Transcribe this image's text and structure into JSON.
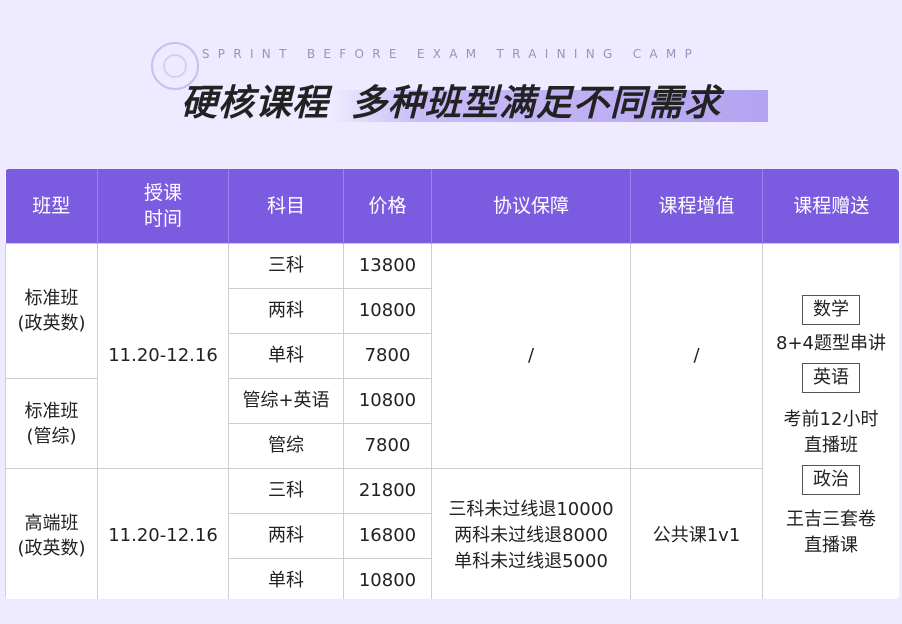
{
  "header": {
    "subtitle": "SPRINT BEFORE EXAM TRAINING CAMP",
    "title_left": "硬核课程",
    "title_right": "多种班型满足不同需求"
  },
  "table": {
    "columns": [
      "班型",
      "授课\n时间",
      "科目",
      "价格",
      "协议保障",
      "课程增值",
      "课程赠送"
    ],
    "groups": [
      {
        "class_type": "标准班\n(政英数)",
        "time": "11.20-12.16",
        "rows": [
          {
            "subject": "三科",
            "price": "13800"
          },
          {
            "subject": "两科",
            "price": "10800"
          },
          {
            "subject": "单科",
            "price": "7800"
          }
        ]
      },
      {
        "class_type": "标准班\n(管综)",
        "rows": [
          {
            "subject": "管综+英语",
            "price": "10800"
          },
          {
            "subject": "管综",
            "price": "7800"
          }
        ]
      },
      {
        "class_type": "高端班\n(政英数)",
        "time": "11.20-12.16",
        "guarantee": [
          "三科未过线退10000",
          "两科未过线退8000",
          "单科未过线退5000"
        ],
        "value_add": "公共课1v1",
        "rows": [
          {
            "subject": "三科",
            "price": "21800"
          },
          {
            "subject": "两科",
            "price": "16800"
          },
          {
            "subject": "单科",
            "price": "10800"
          }
        ]
      }
    ],
    "standard_guarantee": "/",
    "standard_value_add": "/",
    "gifts": [
      {
        "tag": "数学",
        "desc": [
          "8+4题型串讲"
        ]
      },
      {
        "tag": "英语",
        "desc": [
          "考前12小时",
          "直播班"
        ]
      },
      {
        "tag": "政治",
        "desc": [
          "王吉三套卷",
          "直播课"
        ]
      }
    ]
  },
  "colors": {
    "background": "#eeeaff",
    "header_bg": "#7b5ce0",
    "accent": "#a596f0"
  }
}
